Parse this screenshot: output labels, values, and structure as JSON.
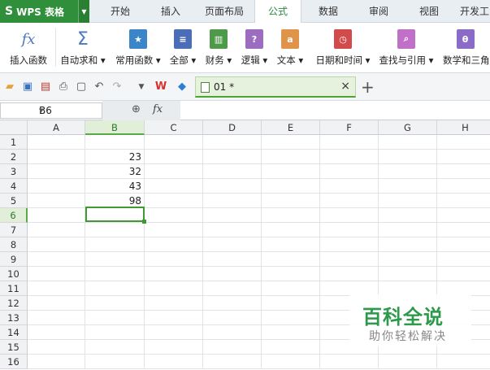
{
  "app": {
    "logo": "S",
    "title": "WPS 表格"
  },
  "tabs": [
    "开始",
    "插入",
    "页面布局",
    "公式",
    "数据",
    "审阅",
    "视图",
    "开发工"
  ],
  "active_tab": "公式",
  "ribbon": [
    {
      "label": "插入函数",
      "icon": "fx-icon",
      "color": "#5a7fc0"
    },
    {
      "label": "自动求和 ▾",
      "icon": "sigma-icon",
      "color": "#4a78c2"
    },
    {
      "label": "常用函数 ▾",
      "icon": "star-book-icon",
      "color": "#3a86c8"
    },
    {
      "label": "全部 ▾",
      "icon": "book-list-icon",
      "color": "#4b6cb7"
    },
    {
      "label": "财务 ▾",
      "icon": "finance-book-icon",
      "color": "#4e9a4a"
    },
    {
      "label": "逻辑 ▾",
      "icon": "logic-book-icon",
      "color": "#9b6cc0"
    },
    {
      "label": "文本 ▾",
      "icon": "text-book-icon",
      "color": "#e0944a"
    },
    {
      "label": "日期和时间 ▾",
      "icon": "clock-book-icon",
      "color": "#d24a4a"
    },
    {
      "label": "查找与引用 ▾",
      "icon": "search-book-icon",
      "color": "#c070c8"
    },
    {
      "label": "数学和三角",
      "icon": "math-book-icon",
      "color": "#8a6cc8"
    }
  ],
  "document_tab": {
    "name": "01 *",
    "close": "×"
  },
  "new_tab": "+",
  "formula_bar": {
    "cell_ref": "B6",
    "fx": "fx",
    "content": ""
  },
  "columns": [
    "A",
    "B",
    "C",
    "D",
    "E",
    "F",
    "G",
    "H"
  ],
  "rows": [
    "1",
    "2",
    "3",
    "4",
    "5",
    "6",
    "7",
    "8",
    "9",
    "10",
    "11",
    "12",
    "13",
    "14",
    "15",
    "16"
  ],
  "cells": {
    "B2": "23",
    "B3": "32",
    "B4": "43",
    "B5": "98"
  },
  "selected_cell": "B6",
  "watermark": {
    "title": "百科全说",
    "subtitle": "助你轻松解决"
  },
  "colors": {
    "accent": "#2f8f3a",
    "selection": "#3f9b2f"
  }
}
